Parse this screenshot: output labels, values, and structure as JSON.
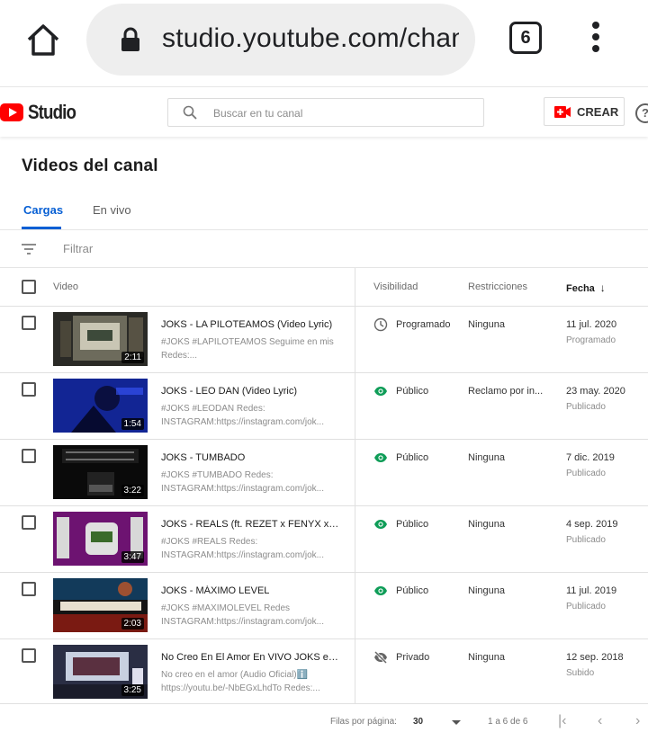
{
  "browser": {
    "url": "studio.youtube.com/channel",
    "tab_count": "6"
  },
  "header": {
    "logo_text": "Studio",
    "search_placeholder": "Buscar en tu canal",
    "create_label": "CREAR",
    "help_label": "?"
  },
  "page": {
    "title": "Videos del canal",
    "tabs": [
      {
        "label": "Cargas",
        "active": true
      },
      {
        "label": "En vivo",
        "active": false
      }
    ],
    "filter_label": "Filtrar"
  },
  "table": {
    "columns": {
      "video": "Video",
      "visibility": "Visibilidad",
      "restrictions": "Restricciones",
      "date": "Fecha"
    },
    "rows": [
      {
        "title": "JOKS - LA PILOTEAMOS (Video Lyric)",
        "description": "#JOKS #LAPILOTEAMOS Seguime en mis Redes:...",
        "duration": "2:11",
        "visibility": "Programado",
        "visibility_icon": "clock-icon",
        "restrictions": "Ninguna",
        "date": "11 jul. 2020",
        "date_status": "Programado"
      },
      {
        "title": "JOKS - LEO DAN (Video Lyric)",
        "description": "#JOKS #LEODAN Redes: INSTAGRAM:https://instagram.com/jok...",
        "duration": "1:54",
        "visibility": "Público",
        "visibility_icon": "eye-icon",
        "restrictions": "Reclamo por in...",
        "date": "23 may. 2020",
        "date_status": "Publicado"
      },
      {
        "title": "JOKS - TUMBADO",
        "description": "#JOKS #TUMBADO Redes: INSTAGRAM:https://instagram.com/jok...",
        "duration": "3:22",
        "visibility": "Público",
        "visibility_icon": "eye-icon",
        "restrictions": "Ninguna",
        "date": "7 dic. 2019",
        "date_status": "Publicado"
      },
      {
        "title": "JOKS - REALS (ft. REZET x FENYX x DI...",
        "description": "#JOKS #REALS Redes: INSTAGRAM:https://instagram.com/jok...",
        "duration": "3:47",
        "visibility": "Público",
        "visibility_icon": "eye-icon",
        "restrictions": "Ninguna",
        "date": "4 sep. 2019",
        "date_status": "Publicado"
      },
      {
        "title": "JOKS - MÁXIMO LEVEL",
        "description": "#JOKS #MAXIMOLEVEL Redes INSTAGRAM:https://instagram.com/jok...",
        "duration": "2:03",
        "visibility": "Público",
        "visibility_icon": "eye-icon",
        "restrictions": "Ninguna",
        "date": "11 jul. 2019",
        "date_status": "Publicado"
      },
      {
        "title": "No Creo En El Amor En VIVO JOKS en ...",
        "description": "No creo en el amor (Audio Oficial)ℹ️ https://youtu.be/-NbEGxLhdTo Redes:...",
        "duration": "3:25",
        "visibility": "Privado",
        "visibility_icon": "eye-off-icon",
        "restrictions": "Ninguna",
        "date": "12 sep. 2018",
        "date_status": "Subido"
      }
    ]
  },
  "pagination": {
    "rows_per_page_label": "Filas por página:",
    "rows_per_page": "30",
    "range": "1 a 6 de 6"
  },
  "colors": {
    "accent_blue": "#065fd4",
    "public_green": "#0f9d58",
    "youtube_red": "#ff0000"
  }
}
